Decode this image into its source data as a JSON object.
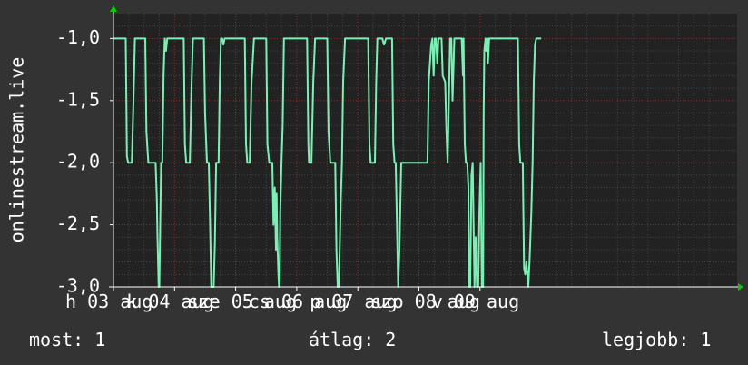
{
  "chart_data": {
    "type": "line",
    "ylabel": "onlinestream.live",
    "ylim": [
      -3.0,
      -0.8
    ],
    "y_ticks": [
      {
        "value": -1.0,
        "label": "-1,0"
      },
      {
        "value": -1.5,
        "label": "-1,5"
      },
      {
        "value": -2.0,
        "label": "-2,0"
      },
      {
        "value": -2.5,
        "label": "-2,5"
      },
      {
        "value": -3.0,
        "label": "-3,0"
      }
    ],
    "xlim": [
      0,
      7
    ],
    "x_ticks": [
      {
        "value": 0,
        "label": "h 03 aug"
      },
      {
        "value": 1,
        "label": "k 04 aug"
      },
      {
        "value": 2,
        "label": "sze 05 aug"
      },
      {
        "value": 3,
        "label": "cs 06 aug"
      },
      {
        "value": 4,
        "label": "p 07 aug"
      },
      {
        "value": 5,
        "label": "szo 08 aug"
      },
      {
        "value": 6,
        "label": "v 09 aug"
      }
    ],
    "grid": true,
    "line_color": "#7cf0b4",
    "series": [
      {
        "x": [
          0.0,
          0.2,
          0.22,
          0.24,
          0.3,
          0.33,
          0.35,
          0.37,
          0.52,
          0.54,
          0.57,
          0.69,
          0.71,
          0.72,
          0.74,
          0.75,
          0.77,
          0.78,
          0.8,
          0.82,
          0.84,
          0.86,
          0.88,
          0.89,
          0.92,
          0.93,
          0.95,
          1.15,
          1.17,
          1.19,
          1.25,
          1.28,
          1.3,
          1.32,
          1.48,
          1.5,
          1.53,
          1.56,
          1.58,
          1.6,
          1.64,
          1.66,
          1.68,
          1.72,
          1.74,
          1.76,
          1.78,
          1.8,
          1.82,
          1.84,
          2.15,
          2.17,
          2.19,
          2.23,
          2.26,
          2.3,
          2.32,
          2.5,
          2.52,
          2.55,
          2.6,
          2.62,
          2.64,
          2.66,
          2.67,
          2.68,
          2.7,
          2.71,
          2.72,
          2.73,
          2.75,
          2.77,
          2.79,
          3.17,
          3.19,
          3.2,
          3.24,
          3.27,
          3.3,
          3.32,
          3.5,
          3.52,
          3.55,
          3.63,
          3.65,
          3.67,
          3.69,
          3.72,
          3.74,
          3.76,
          3.79,
          4.17,
          4.19,
          4.21,
          4.28,
          4.3,
          4.32,
          4.34,
          4.4,
          4.43,
          4.46,
          4.56,
          4.58,
          4.6,
          4.62,
          4.64,
          4.66,
          4.68,
          4.71,
          5.12,
          5.14,
          5.16,
          5.2,
          5.22,
          5.24,
          5.26,
          5.28,
          5.3,
          5.32,
          5.34,
          5.37,
          5.39,
          5.43,
          5.45,
          5.47,
          5.49,
          5.51,
          5.53,
          5.55,
          5.58,
          5.7,
          5.72,
          5.73,
          5.75,
          5.77,
          5.79,
          5.81,
          5.82,
          5.84,
          5.86,
          5.88,
          5.91,
          5.93,
          5.95,
          5.97,
          5.99,
          6.01,
          6.03,
          6.05,
          6.06,
          6.07,
          6.09,
          6.1,
          6.12,
          6.13,
          6.15,
          6.17,
          6.19,
          6.21,
          6.23,
          6.25,
          6.27,
          6.29,
          6.62,
          6.64,
          6.66,
          6.7,
          6.72,
          6.74,
          6.76,
          6.79,
          6.81,
          6.84,
          6.86,
          6.88,
          6.9,
          6.92,
          6.94,
          6.96,
          6.98,
          7.0
        ],
        "y": [
          -1.0,
          -1.0,
          -1.95,
          -2.0,
          -2.0,
          -1.45,
          -1.0,
          -1.0,
          -1.0,
          -1.75,
          -2.0,
          -2.0,
          -2.3,
          -2.6,
          -3.0,
          -3.0,
          -2.35,
          -2.0,
          -2.0,
          -1.3,
          -1.0,
          -1.1,
          -1.0,
          -1.0,
          -1.0,
          -1.0,
          -1.0,
          -1.0,
          -1.85,
          -2.0,
          -2.0,
          -1.35,
          -1.0,
          -1.0,
          -1.0,
          -1.6,
          -2.0,
          -2.0,
          -2.45,
          -3.0,
          -3.0,
          -2.65,
          -2.0,
          -2.0,
          -1.35,
          -1.0,
          -1.0,
          -1.05,
          -1.0,
          -1.0,
          -1.0,
          -1.85,
          -2.0,
          -2.0,
          -1.35,
          -1.0,
          -1.0,
          -1.0,
          -1.85,
          -2.0,
          -2.0,
          -2.5,
          -2.2,
          -2.7,
          -2.25,
          -2.6,
          -2.9,
          -3.0,
          -3.0,
          -2.4,
          -2.0,
          -1.7,
          -1.0,
          -1.0,
          -1.85,
          -2.0,
          -2.0,
          -1.35,
          -1.0,
          -1.0,
          -1.0,
          -1.75,
          -2.0,
          -2.0,
          -2.7,
          -3.0,
          -3.0,
          -2.3,
          -2.0,
          -1.35,
          -1.0,
          -1.0,
          -1.85,
          -2.0,
          -2.0,
          -1.35,
          -1.0,
          -1.0,
          -1.0,
          -1.05,
          -1.0,
          -1.0,
          -1.85,
          -2.0,
          -2.0,
          -2.5,
          -3.0,
          -2.7,
          -2.0,
          -2.0,
          -2.0,
          -1.35,
          -1.05,
          -1.0,
          -1.3,
          -1.0,
          -1.0,
          -1.2,
          -1.0,
          -1.0,
          -1.0,
          -1.3,
          -1.35,
          -1.75,
          -2.0,
          -1.5,
          -1.0,
          -1.0,
          -1.5,
          -1.0,
          -1.0,
          -1.3,
          -1.0,
          -1.85,
          -2.0,
          -2.0,
          -2.2,
          -3.0,
          -3.0,
          -2.1,
          -2.0,
          -3.0,
          -2.6,
          -3.0,
          -3.0,
          -2.4,
          -2.0,
          -3.0,
          -3.0,
          -1.6,
          -1.1,
          -1.0,
          -1.1,
          -1.0,
          -1.2,
          -1.0,
          -1.0,
          -1.0,
          -1.0,
          -1.0,
          -1.0,
          -1.0,
          -1.0,
          -1.0,
          -1.85,
          -2.0,
          -2.0,
          -2.85,
          -2.9,
          -2.8,
          -3.0,
          -2.8,
          -2.4,
          -2.0,
          -1.35,
          -1.05,
          -1.0,
          -1.0,
          -1.0,
          -1.0,
          -1.0
        ]
      }
    ]
  },
  "stats": {
    "current": "most: 1",
    "average": "átlag: 2",
    "best": "legjobb: 1"
  }
}
